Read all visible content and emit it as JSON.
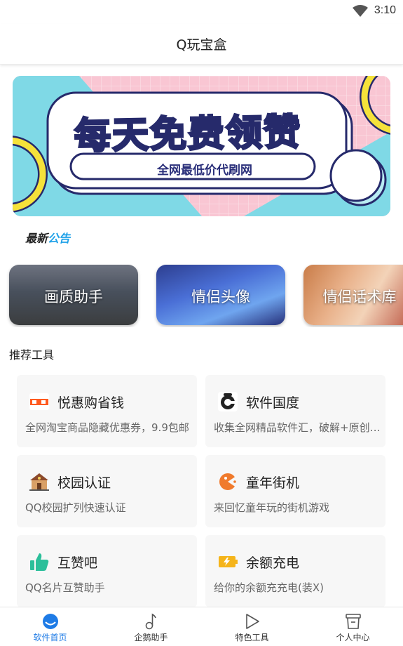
{
  "status_bar": {
    "time": "3:10",
    "icons": [
      "wifi-icon"
    ]
  },
  "app_bar": {
    "title": "Q玩宝盒"
  },
  "banner": {
    "headline": "每天免费领赞",
    "subline": "全网最低价代刷网",
    "colors": {
      "pink": "#f9c6d3",
      "cyan": "#7fd9e6",
      "yellow": "#f5e23a",
      "navy": "#262a6b"
    }
  },
  "notice": {
    "logo_part1": "最新",
    "logo_part2": "公告"
  },
  "carousel": [
    {
      "label": "画质助手"
    },
    {
      "label": "情侣头像"
    },
    {
      "label": "情侣话术库"
    }
  ],
  "section": {
    "title": "推荐工具"
  },
  "tools": [
    {
      "name": "悦惠购省钱",
      "desc": "全网淘宝商品隐藏优惠券，9.9包邮",
      "icon": "taoquan-icon"
    },
    {
      "name": "软件国度",
      "desc": "收集全网精品软件汇，破解+原创软件",
      "icon": "software-icon"
    },
    {
      "name": "校园认证",
      "desc": "QQ校园扩列快速认证",
      "icon": "school-icon"
    },
    {
      "name": "童年街机",
      "desc": "来回忆童年玩的街机游戏",
      "icon": "arcade-icon"
    },
    {
      "name": "互赞吧",
      "desc": "QQ名片互赞助手",
      "icon": "thumbs-up-icon"
    },
    {
      "name": "余额充电",
      "desc": "给你的余额充充电(装X)",
      "icon": "battery-icon"
    }
  ],
  "bottom_nav": [
    {
      "label": "软件首页",
      "icon": "home-icon",
      "active": true
    },
    {
      "label": "企鹅助手",
      "icon": "music-note-icon",
      "active": false
    },
    {
      "label": "特色工具",
      "icon": "play-icon",
      "active": false
    },
    {
      "label": "个人中心",
      "icon": "cup-icon",
      "active": false
    }
  ],
  "accent_color": "#1e7be6"
}
